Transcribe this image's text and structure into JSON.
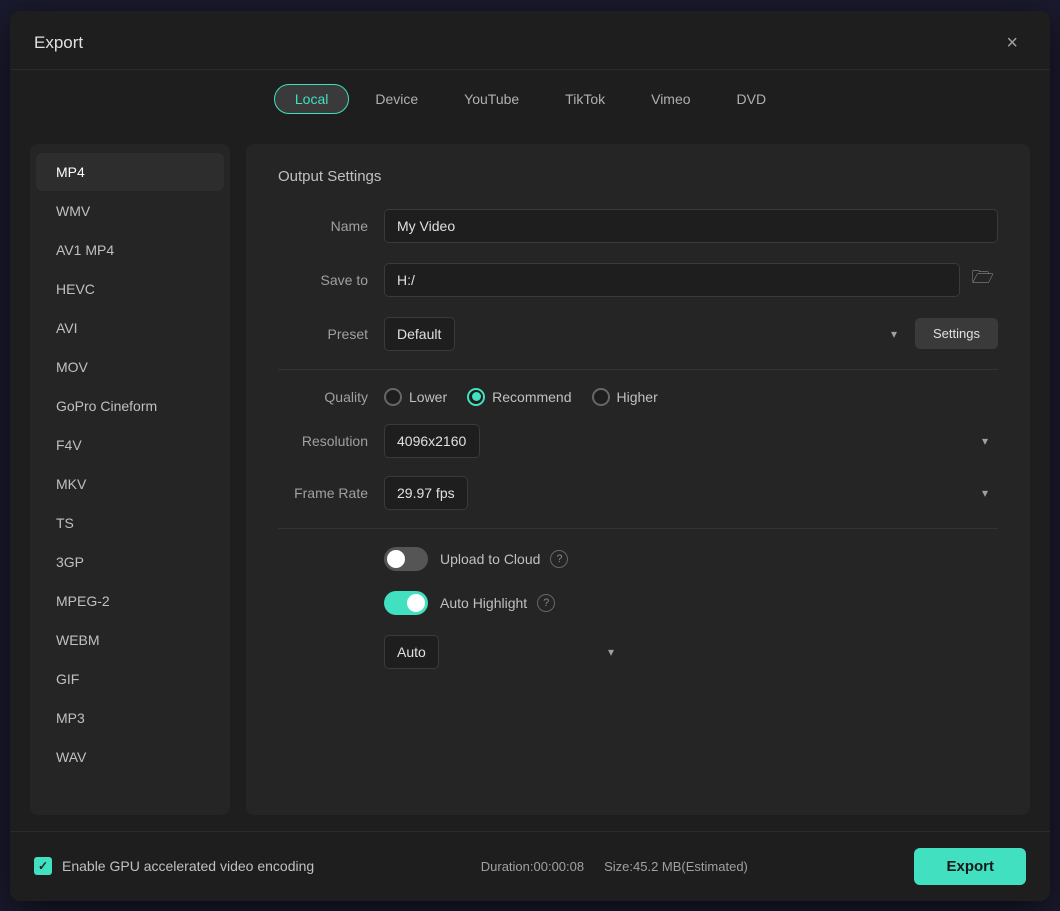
{
  "dialog": {
    "title": "Export",
    "close_label": "×"
  },
  "tabs": [
    {
      "id": "local",
      "label": "Local",
      "active": true
    },
    {
      "id": "device",
      "label": "Device",
      "active": false
    },
    {
      "id": "youtube",
      "label": "YouTube",
      "active": false
    },
    {
      "id": "tiktok",
      "label": "TikTok",
      "active": false
    },
    {
      "id": "vimeo",
      "label": "Vimeo",
      "active": false
    },
    {
      "id": "dvd",
      "label": "DVD",
      "active": false
    }
  ],
  "formats": [
    {
      "id": "mp4",
      "label": "MP4",
      "active": true
    },
    {
      "id": "wmv",
      "label": "WMV",
      "active": false
    },
    {
      "id": "av1mp4",
      "label": "AV1 MP4",
      "active": false
    },
    {
      "id": "hevc",
      "label": "HEVC",
      "active": false
    },
    {
      "id": "avi",
      "label": "AVI",
      "active": false
    },
    {
      "id": "mov",
      "label": "MOV",
      "active": false
    },
    {
      "id": "gopro",
      "label": "GoPro Cineform",
      "active": false
    },
    {
      "id": "f4v",
      "label": "F4V",
      "active": false
    },
    {
      "id": "mkv",
      "label": "MKV",
      "active": false
    },
    {
      "id": "ts",
      "label": "TS",
      "active": false
    },
    {
      "id": "3gp",
      "label": "3GP",
      "active": false
    },
    {
      "id": "mpeg2",
      "label": "MPEG-2",
      "active": false
    },
    {
      "id": "webm",
      "label": "WEBM",
      "active": false
    },
    {
      "id": "gif",
      "label": "GIF",
      "active": false
    },
    {
      "id": "mp3",
      "label": "MP3",
      "active": false
    },
    {
      "id": "wav",
      "label": "WAV",
      "active": false
    }
  ],
  "output": {
    "section_title": "Output Settings",
    "name_label": "Name",
    "name_value": "My Video",
    "save_to_label": "Save to",
    "save_to_value": "H:/",
    "preset_label": "Preset",
    "preset_value": "Default",
    "settings_label": "Settings",
    "quality_label": "Quality",
    "quality_options": [
      {
        "id": "lower",
        "label": "Lower",
        "selected": false
      },
      {
        "id": "recommend",
        "label": "Recommend",
        "selected": true
      },
      {
        "id": "higher",
        "label": "Higher",
        "selected": false
      }
    ],
    "resolution_label": "Resolution",
    "resolution_value": "4096x2160",
    "frame_rate_label": "Frame Rate",
    "frame_rate_value": "29.97 fps",
    "upload_to_cloud_label": "Upload to Cloud",
    "upload_to_cloud_on": false,
    "auto_highlight_label": "Auto Highlight",
    "auto_highlight_on": true,
    "auto_select_value": "Auto"
  },
  "footer": {
    "gpu_label": "Enable GPU accelerated video encoding",
    "duration_label": "Duration:00:00:08",
    "size_label": "Size:45.2 MB(Estimated)",
    "export_label": "Export"
  }
}
